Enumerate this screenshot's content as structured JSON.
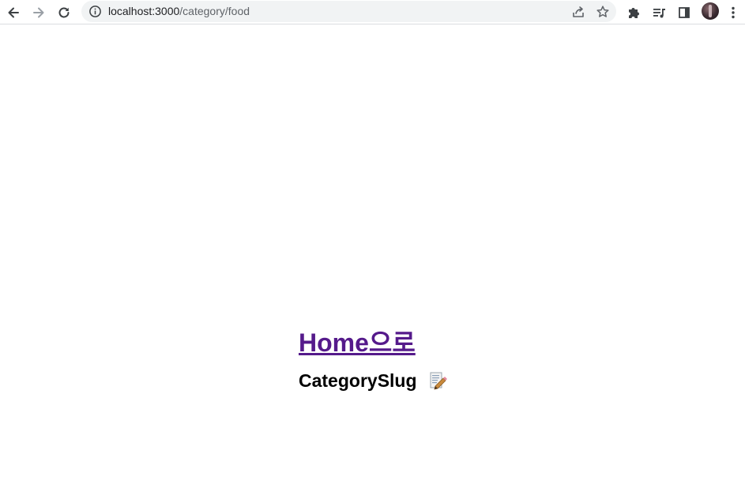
{
  "browser": {
    "url_host": "localhost:3000",
    "url_path": "/category/food",
    "icons": {
      "back": "arrow-left-icon",
      "forward": "arrow-right-icon",
      "reload": "reload-icon",
      "site_info": "info-icon",
      "share": "share-icon",
      "bookmark": "star-icon",
      "extensions": "puzzle-icon",
      "media": "media-playlist-icon",
      "side_panel": "side-panel-icon",
      "profile": "avatar",
      "menu": "kebab-menu-icon"
    }
  },
  "page": {
    "home_link": "Home으로",
    "slug_title": "CategorySlug",
    "edit_icon": "memo-icon",
    "link_color": "#551a8b"
  }
}
